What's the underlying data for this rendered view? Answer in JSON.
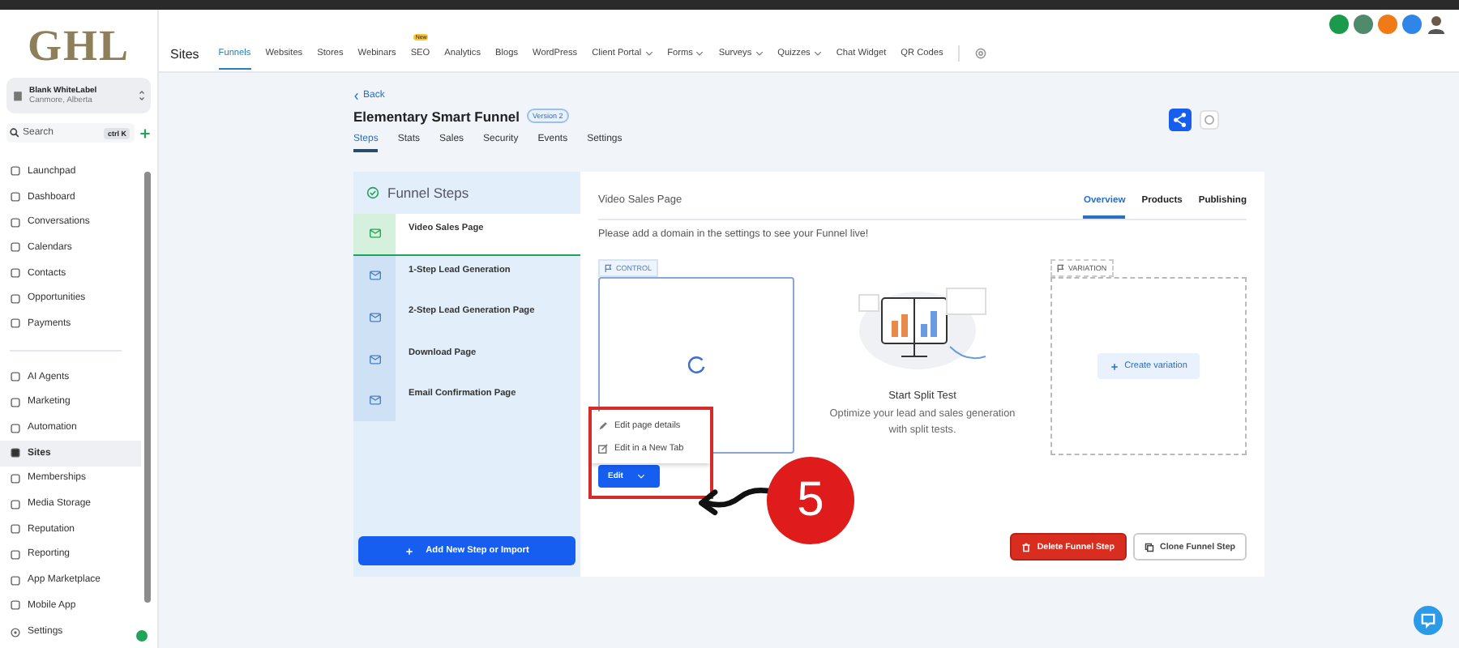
{
  "sidebar": {
    "logo": "GHL",
    "account": {
      "name": "Blank WhiteLabel",
      "location": "Canmore, Alberta"
    },
    "search": {
      "placeholder": "Search",
      "shortcut": "ctrl K"
    },
    "groups": [
      [
        {
          "label": "Launchpad",
          "selected": false
        },
        {
          "label": "Dashboard",
          "selected": false
        },
        {
          "label": "Conversations",
          "selected": false
        },
        {
          "label": "Calendars",
          "selected": false
        },
        {
          "label": "Contacts",
          "selected": false
        },
        {
          "label": "Opportunities",
          "selected": false
        },
        {
          "label": "Payments",
          "selected": false
        }
      ],
      [
        {
          "label": "AI Agents",
          "selected": false
        },
        {
          "label": "Marketing",
          "selected": false
        },
        {
          "label": "Automation",
          "selected": false
        },
        {
          "label": "Sites",
          "selected": true
        },
        {
          "label": "Memberships",
          "selected": false
        },
        {
          "label": "Media Storage",
          "selected": false
        },
        {
          "label": "Reputation",
          "selected": false
        },
        {
          "label": "Reporting",
          "selected": false
        },
        {
          "label": "App Marketplace",
          "selected": false
        },
        {
          "label": "Mobile App",
          "selected": false
        }
      ]
    ],
    "settings": "Settings"
  },
  "topnav": {
    "section": "Sites",
    "tabs": [
      {
        "label": "Funnels",
        "selected": true,
        "caret": false
      },
      {
        "label": "Websites",
        "selected": false,
        "caret": false
      },
      {
        "label": "Stores",
        "selected": false,
        "caret": false
      },
      {
        "label": "Webinars",
        "selected": false,
        "caret": false
      },
      {
        "label": "SEO",
        "selected": false,
        "caret": false,
        "badge": "New"
      },
      {
        "label": "Analytics",
        "selected": false,
        "caret": false
      },
      {
        "label": "Blogs",
        "selected": false,
        "caret": false
      },
      {
        "label": "WordPress",
        "selected": false,
        "caret": false
      },
      {
        "label": "Client Portal",
        "selected": false,
        "caret": true
      },
      {
        "label": "Forms",
        "selected": false,
        "caret": true
      },
      {
        "label": "Surveys",
        "selected": false,
        "caret": true
      },
      {
        "label": "Quizzes",
        "selected": false,
        "caret": true
      },
      {
        "label": "Chat Widget",
        "selected": false,
        "caret": false
      },
      {
        "label": "QR Codes",
        "selected": false,
        "caret": false
      }
    ]
  },
  "header": {
    "back": "Back",
    "title": "Elementary Smart Funnel",
    "version": "Version 2",
    "tabs": [
      {
        "label": "Steps",
        "selected": true
      },
      {
        "label": "Stats",
        "selected": false
      },
      {
        "label": "Sales",
        "selected": false
      },
      {
        "label": "Security",
        "selected": false
      },
      {
        "label": "Events",
        "selected": false
      },
      {
        "label": "Settings",
        "selected": false
      }
    ]
  },
  "steps_panel": {
    "title": "Funnel Steps",
    "steps": [
      {
        "label": "Video Sales Page",
        "selected": true
      },
      {
        "label": "1-Step Lead Generation",
        "selected": false
      },
      {
        "label": "2-Step Lead Generation Page",
        "selected": false
      },
      {
        "label": "Download Page",
        "selected": false
      },
      {
        "label": "Email Confirmation Page",
        "selected": false
      }
    ],
    "add_button": "Add New Step or Import"
  },
  "step_card": {
    "title": "Video Sales Page",
    "tabs": [
      {
        "label": "Overview",
        "selected": true
      },
      {
        "label": "Products",
        "selected": false
      },
      {
        "label": "Publishing",
        "selected": false
      }
    ],
    "notice": "Please add a domain in the settings to see your Funnel live!",
    "control_tag": "CONTROL",
    "edit_button": "Edit",
    "edit_menu": [
      {
        "kind": "edit",
        "label": "Edit page details"
      },
      {
        "kind": "external",
        "label": "Edit in a New Tab"
      }
    ],
    "split_test": {
      "title": "Start Split Test",
      "description": "Optimize your lead and sales generation with split tests."
    },
    "variation_tag": "VARIATION",
    "create_variation": "Create variation",
    "delete_button": "Delete Funnel Step",
    "clone_button": "Clone Funnel Step"
  },
  "annotation": {
    "step": "5"
  }
}
